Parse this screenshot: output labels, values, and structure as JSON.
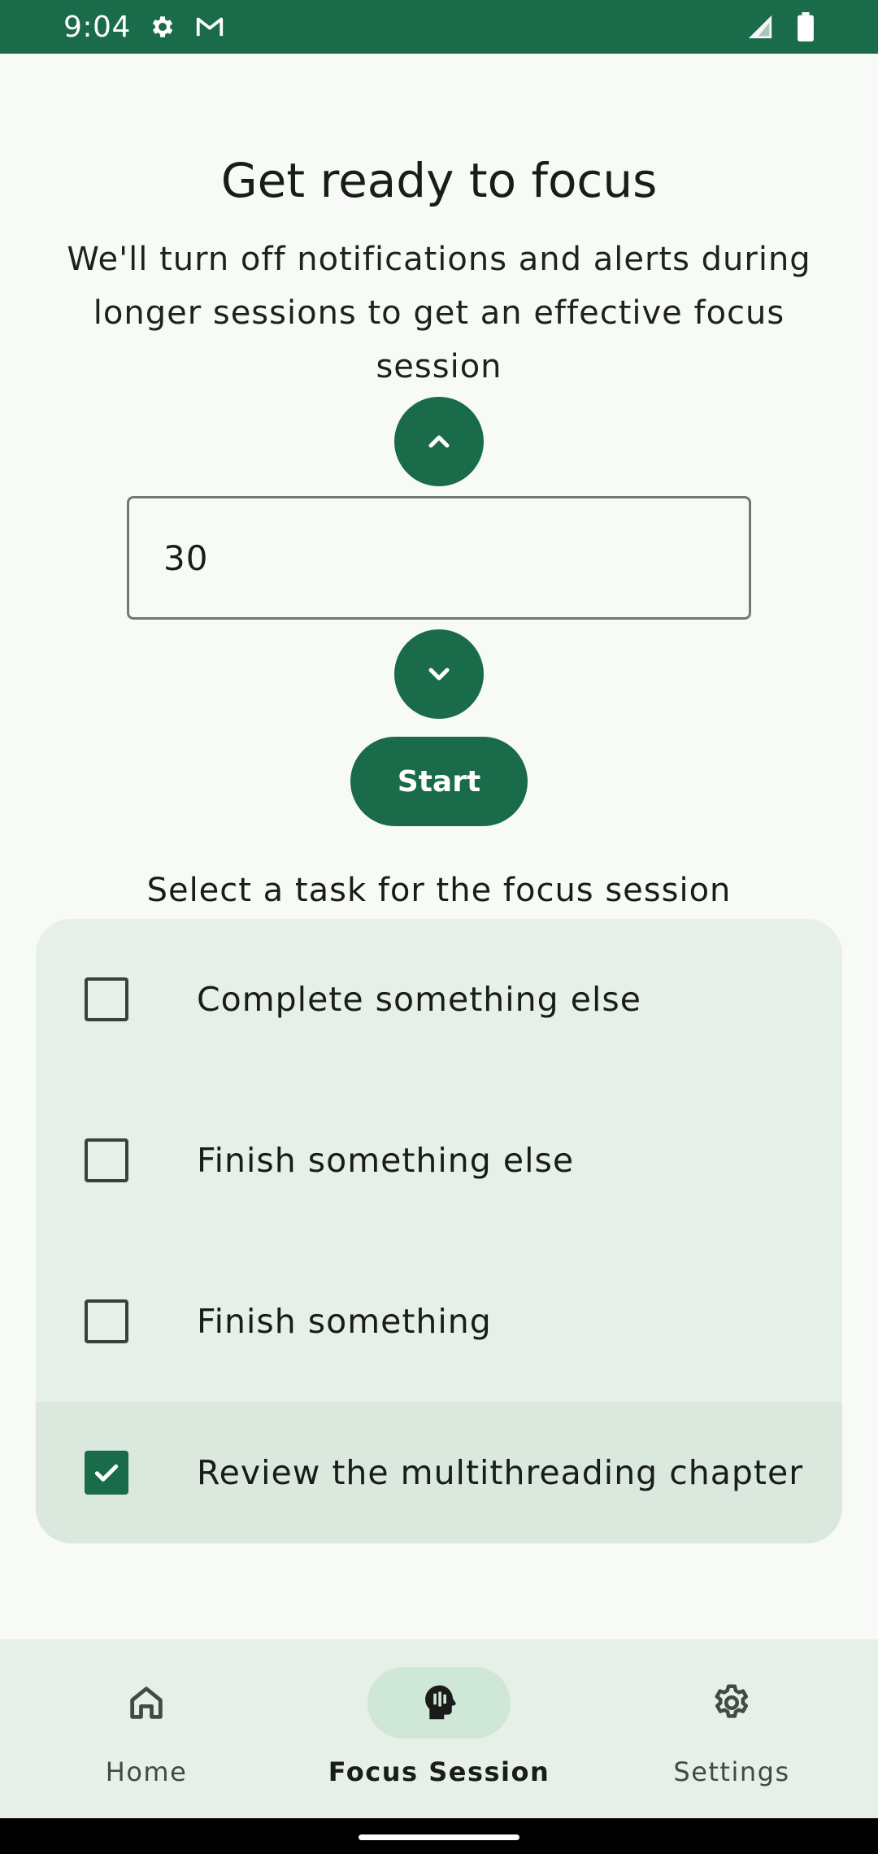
{
  "status_bar": {
    "time": "9:04",
    "left_icons": [
      "gear-icon",
      "gmail-icon"
    ],
    "right_icons": [
      "signal-icon",
      "battery-icon"
    ],
    "color": "#1a6b4a"
  },
  "main": {
    "title": "Get ready to focus",
    "subtitle": "We'll turn off notifications and alerts during longer sessions to get an effective focus session",
    "duration_value": "30",
    "start_label": "Start",
    "task_heading": "Select a task for the focus session"
  },
  "tasks": [
    {
      "label": "Complete something else",
      "checked": false
    },
    {
      "label": "Finish something else",
      "checked": false
    },
    {
      "label": "Finish something",
      "checked": false
    },
    {
      "label": "Review the multithreading chapter",
      "checked": true
    }
  ],
  "bottom_nav": {
    "items": [
      {
        "label": "Home",
        "icon": "home-icon",
        "active": false
      },
      {
        "label": "Focus Session",
        "icon": "focus-head-icon",
        "active": true
      },
      {
        "label": "Settings",
        "icon": "settings-icon",
        "active": false
      }
    ]
  },
  "colors": {
    "accent": "#1a6b4a",
    "surface": "#e6efe8",
    "selected_row": "#dae8de"
  }
}
